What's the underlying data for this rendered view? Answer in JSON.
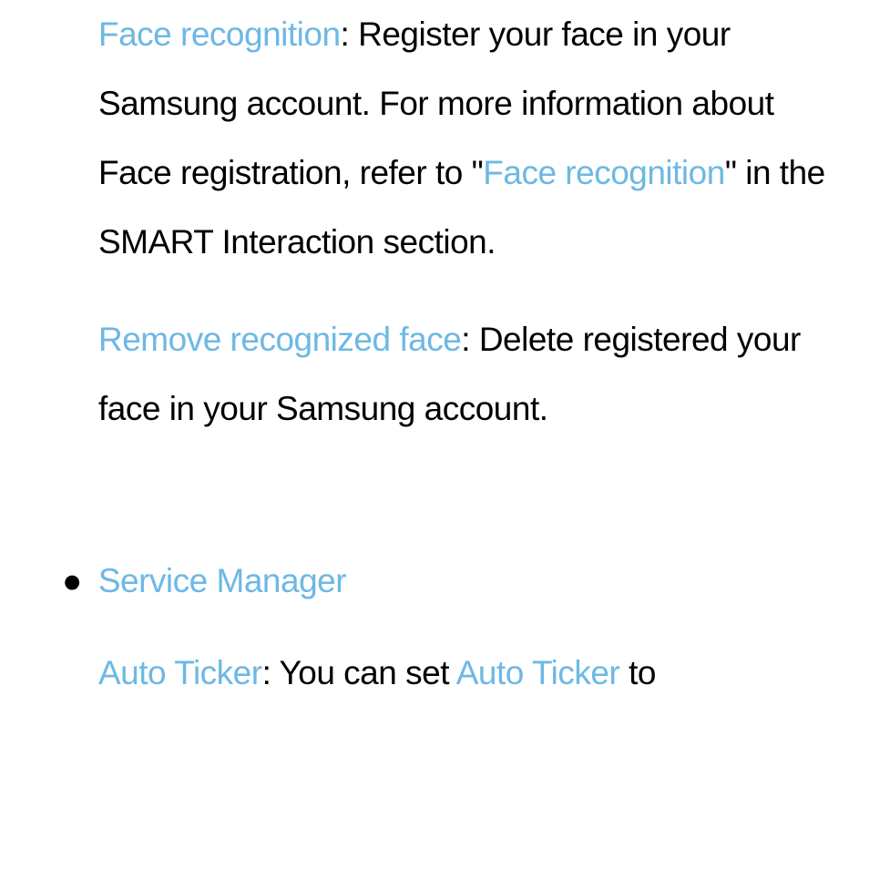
{
  "para1": {
    "link1": "Face recognition",
    "text1": ": Register your face in your Samsung account. For more information about Face registration, refer to \"",
    "link2": "Face recognition",
    "text2": "\" in the SMART Interaction section."
  },
  "para2": {
    "link": "Remove recognized face",
    "text": ": Delete registered your face in your Samsung account."
  },
  "bullet": {
    "dot": "●",
    "title": "Service Manager"
  },
  "para3": {
    "link1": "Auto Ticker",
    "text1": ": You can set ",
    "link2": "Auto Ticker",
    "text2": " to"
  }
}
